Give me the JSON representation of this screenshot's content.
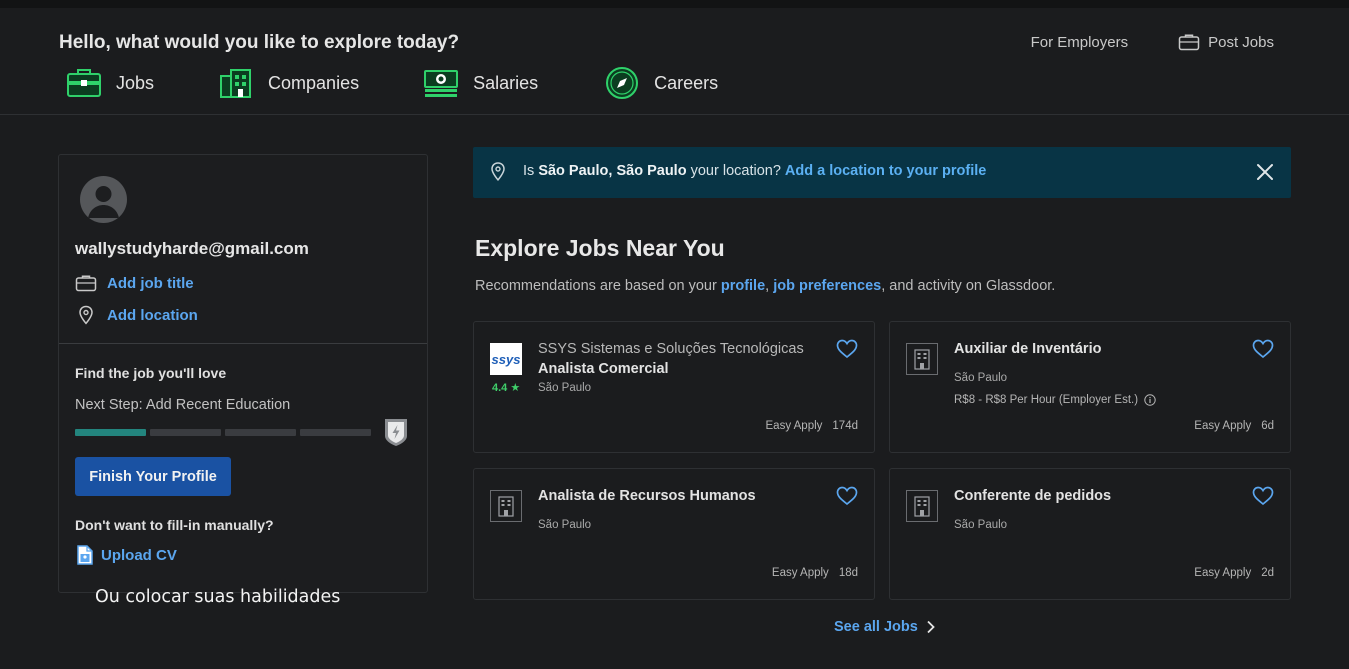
{
  "header": {
    "greeting": "Hello, what would you like to explore today?",
    "for_employers": "For Employers",
    "post_jobs": "Post Jobs",
    "nav": [
      "Jobs",
      "Companies",
      "Salaries",
      "Careers"
    ]
  },
  "profile": {
    "email": "wallystudyharde@gmail.com",
    "add_job_title": "Add job title",
    "add_location": "Add location",
    "find_title": "Find the job you'll love",
    "next_step": "Next Step: Add Recent Education",
    "progress_filled_segments": 1,
    "progress_total_segments": 4,
    "finish_button": "Finish Your Profile",
    "manual_question": "Don't want to fill-in manually?",
    "upload_cv": "Upload CV"
  },
  "overlay_caption": "Ou colocar suas habilidades",
  "banner": {
    "prefix": "Is ",
    "city": "São Paulo, São Paulo",
    "middle": " your location? ",
    "link": "Add a location to your profile"
  },
  "explore": {
    "title": "Explore Jobs Near You",
    "sub_prefix": "Recommendations are based on your ",
    "sub_link1": "profile",
    "sub_sep": ", ",
    "sub_link2": "job preferences",
    "sub_suffix": ", and activity on Glassdoor."
  },
  "jobs": [
    {
      "company": "SSYS Sistemas e Soluções Tecnológicas",
      "title": "Analista Comercial",
      "location": "São Paulo",
      "rating": "4.4 ★",
      "logo_text": "ssys",
      "apply": "Easy Apply",
      "age": "174d"
    },
    {
      "company": "",
      "title": "Auxiliar de Inventário",
      "location": "São Paulo",
      "salary": "R$8 - R$8 Per Hour  (Employer Est.)",
      "apply": "Easy Apply",
      "age": "6d"
    },
    {
      "company": "",
      "title": "Analista de Recursos Humanos",
      "location": "São Paulo",
      "apply": "Easy Apply",
      "age": "18d"
    },
    {
      "company": "",
      "title": "Conferente de pedidos",
      "location": "São Paulo",
      "apply": "Easy Apply",
      "age": "2d"
    }
  ],
  "see_all": "See all Jobs",
  "colors": {
    "accent_link": "#5ba6ef",
    "primary_button": "#1a52a3",
    "progress_fill": "#23857e",
    "banner_bg": "#083445",
    "brand_green": "#0caa41"
  }
}
